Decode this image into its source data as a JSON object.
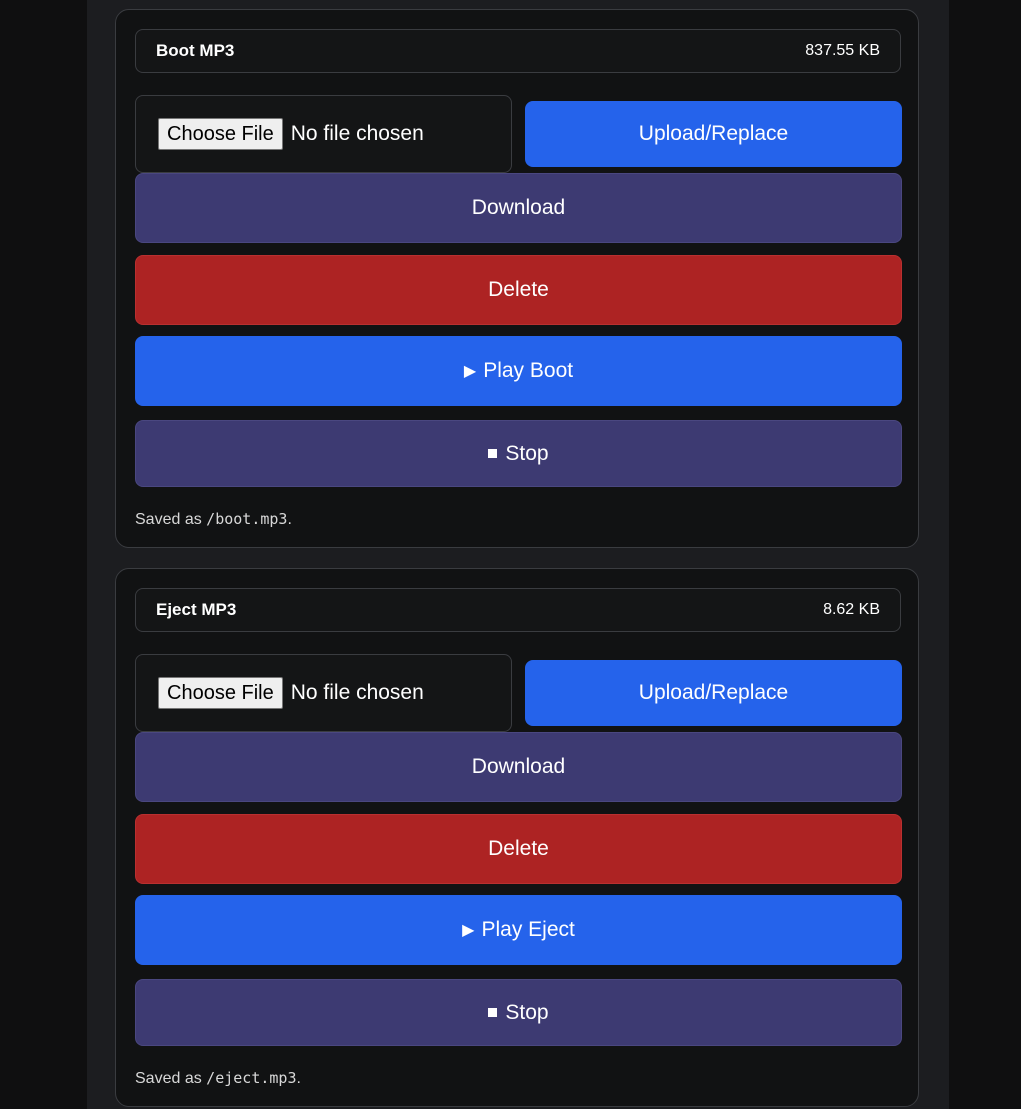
{
  "cards": [
    {
      "title": "Boot MP3",
      "size": "837.55 KB",
      "choose_file_label": "Choose File",
      "no_file_text": "No file chosen",
      "upload_label": "Upload/Replace",
      "download_label": "Download",
      "delete_label": "Delete",
      "play_label": "Play Boot",
      "stop_label": "Stop",
      "note_prefix": "Saved as",
      "note_path": "/boot.mp3",
      "note_suffix": "."
    },
    {
      "title": "Eject MP3",
      "size": "8.62 KB",
      "choose_file_label": "Choose File",
      "no_file_text": "No file chosen",
      "upload_label": "Upload/Replace",
      "download_label": "Download",
      "delete_label": "Delete",
      "play_label": "Play Eject",
      "stop_label": "Stop",
      "note_prefix": "Saved as",
      "note_path": "/eject.mp3",
      "note_suffix": "."
    }
  ],
  "colors": {
    "primary_blue": "#2563eb",
    "secondary_purple": "#3d3a72",
    "danger_red": "#ad2323"
  },
  "icons": {
    "play": "play-icon",
    "stop": "stop-icon"
  }
}
